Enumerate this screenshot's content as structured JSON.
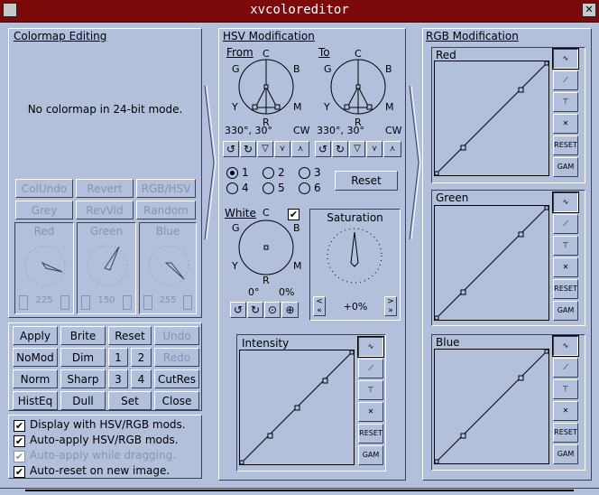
{
  "window": {
    "title": "xvcoloreditor"
  },
  "colormap": {
    "title": "Colormap Editing",
    "message": "No colormap in 24-bit mode.",
    "buttons": [
      "ColUndo",
      "Revert",
      "RGB/HSV",
      "Grey",
      "RevVid",
      "Random"
    ],
    "dials": [
      {
        "label": "Red",
        "value": "225"
      },
      {
        "label": "Green",
        "value": "150"
      },
      {
        "label": "Blue",
        "value": "255"
      }
    ]
  },
  "controls": {
    "buttons": [
      [
        "Apply",
        "Brite",
        "Reset",
        "Undo"
      ],
      [
        "NoMod",
        "Dim",
        "1",
        "2",
        "Redo"
      ],
      [
        "Norm",
        "Sharp",
        "3",
        "4",
        "CutRes"
      ],
      [
        "HistEq",
        "Dull",
        "Set",
        "Close"
      ]
    ]
  },
  "options": [
    {
      "label": "Display with HSV/RGB mods.",
      "checked": true,
      "enabled": true
    },
    {
      "label": "Auto-apply HSV/RGB mods.",
      "checked": true,
      "enabled": true
    },
    {
      "label": "Auto-apply while dragging.",
      "checked": true,
      "enabled": false
    },
    {
      "label": "Auto-reset on new image.",
      "checked": true,
      "enabled": true
    }
  ],
  "hsv": {
    "title": "HSV Modification",
    "from": {
      "label": "From",
      "value": "330°,  30°",
      "dir": "CW"
    },
    "to": {
      "label": "To",
      "value": "330°,  30°",
      "dir": "CW"
    },
    "wheel_labels": {
      "top": "C",
      "tl": "G",
      "tr": "B",
      "bl": "Y",
      "br": "M",
      "bottom": "R"
    },
    "radios": [
      "1",
      "2",
      "3",
      "4",
      "5",
      "6"
    ],
    "reset_label": "Reset",
    "white": {
      "label": "White",
      "angle": "0°",
      "percent": "0%",
      "checked": true
    },
    "saturation": {
      "label": "Saturation",
      "value": "+0%"
    },
    "intensity": {
      "label": "Intensity"
    }
  },
  "rgb": {
    "title": "RGB Modification",
    "channels": [
      "Red",
      "Green",
      "Blue"
    ]
  },
  "graph_buttons": {
    "reset": "RESET",
    "gam": "GAM"
  }
}
